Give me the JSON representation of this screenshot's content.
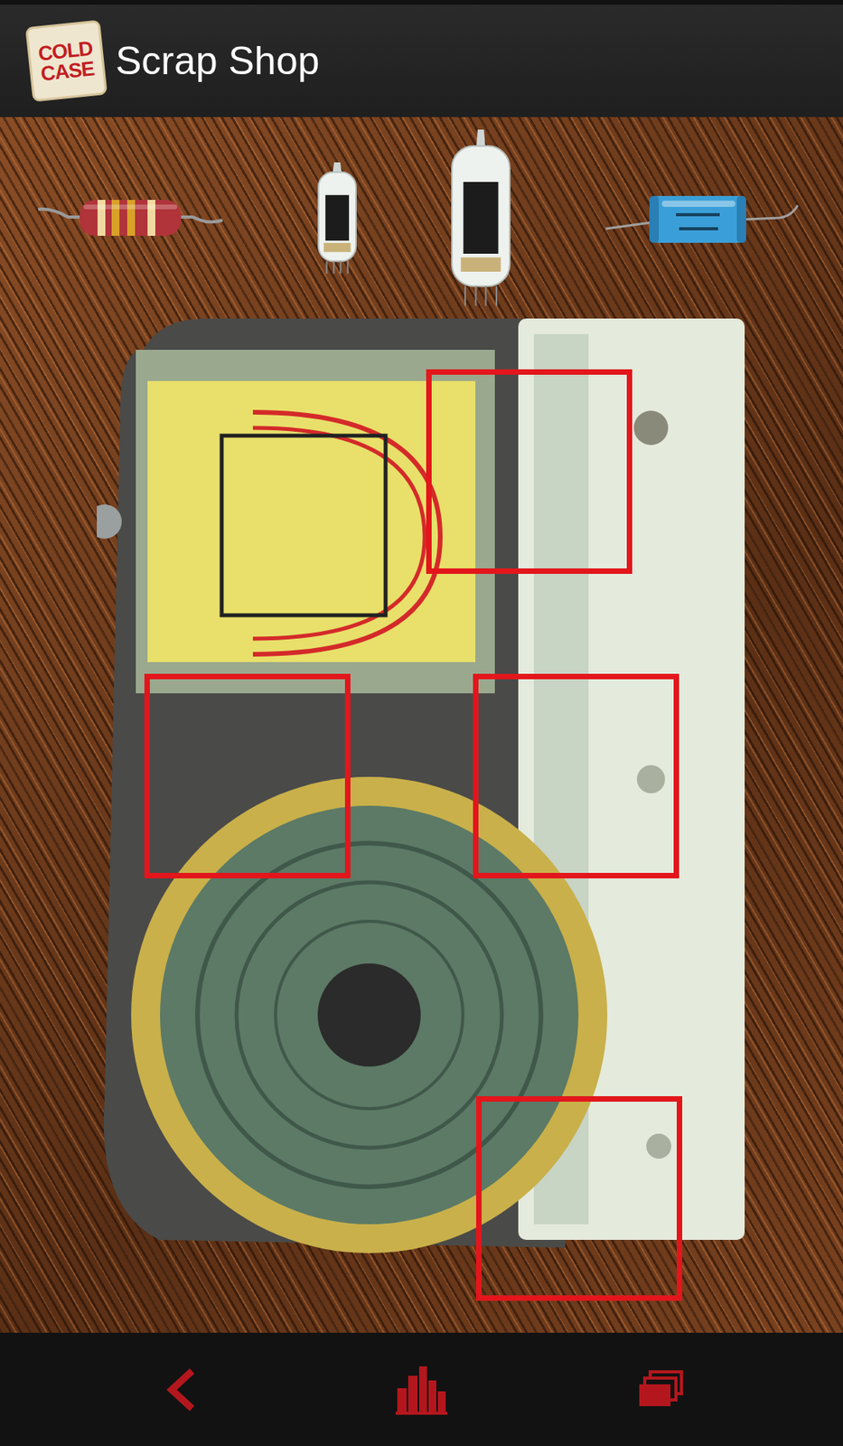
{
  "app_bar": {
    "logo": {
      "line1": "COLD",
      "line2": "CASE"
    },
    "title": "Scrap Shop"
  },
  "parts": [
    {
      "kind": "resistor"
    },
    {
      "kind": "small-tube"
    },
    {
      "kind": "large-tube"
    },
    {
      "kind": "capacitor"
    }
  ],
  "slots": [
    {
      "filled": false
    },
    {
      "filled": false
    },
    {
      "filled": false
    },
    {
      "filled": false
    }
  ],
  "nav": [
    {
      "kind": "back"
    },
    {
      "kind": "city"
    },
    {
      "kind": "cards"
    }
  ]
}
